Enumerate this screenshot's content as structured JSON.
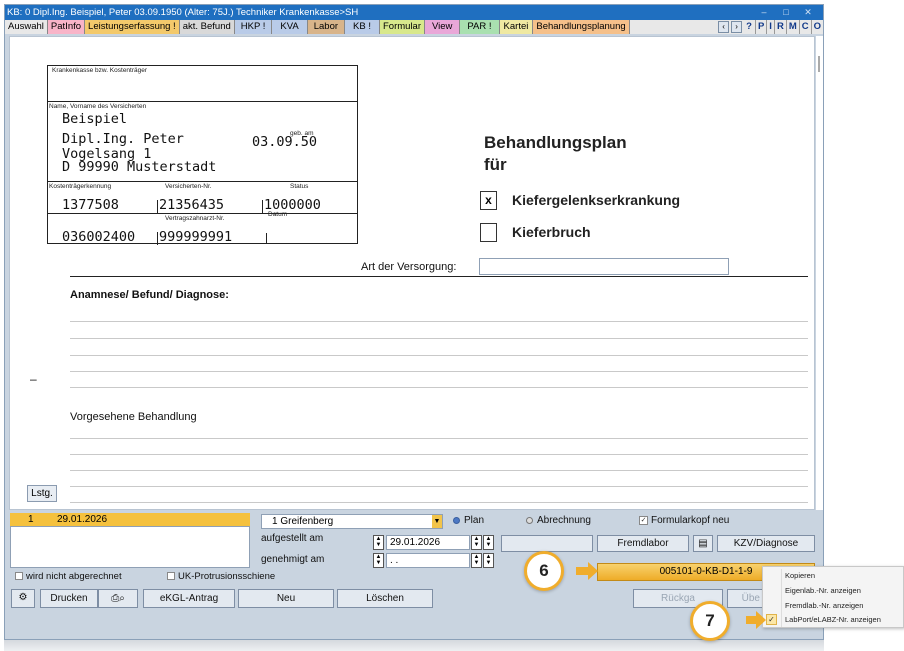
{
  "window": {
    "title": "KB: 0  Dipl.Ing. Beispiel, Peter  03.09.1950 (Alter: 75J.)  Techniker Krankenkasse>SH",
    "controls": [
      "–",
      "□",
      "✕"
    ]
  },
  "tabs": [
    {
      "label": "Auswahl",
      "bg": "#e8e8e8"
    },
    {
      "label": "PatInfo",
      "bg": "#f8b4c8"
    },
    {
      "label": "Leistungserfassung !",
      "bg": "#f3c96b"
    },
    {
      "label": "akt. Befund",
      "bg": "#d9d9d9"
    },
    {
      "label": "HKP !",
      "bg": "#b9cbe8"
    },
    {
      "label": "KVA",
      "bg": "#b9cbe8"
    },
    {
      "label": "Labor",
      "bg": "#d8b48a"
    },
    {
      "label": "KB !",
      "bg": "#b9cbe8"
    },
    {
      "label": "Formular",
      "bg": "#d8e88c"
    },
    {
      "label": "View",
      "bg": "#e9a7d8"
    },
    {
      "label": "PAR !",
      "bg": "#a9e0b0"
    },
    {
      "label": "Kartei",
      "bg": "#efe9a2"
    },
    {
      "label": "Behandlungsplanung",
      "bg": "#f5c08a"
    }
  ],
  "tab_right": {
    "prev": "‹",
    "next": "›",
    "help": "?",
    "letters": [
      "P",
      "I",
      "R",
      "M",
      "C",
      "O"
    ]
  },
  "form": {
    "insurer_label": "Krankenkasse bzw. Kostenträger",
    "name_label": "Name, Vorname des Versicherten",
    "surname": "Beispiel",
    "firstname": "Dipl.Ing. Peter",
    "born_label": "geb. am",
    "born": "03.09.50",
    "street": "Vogelsang 1",
    "city": "D 99990 Musterstadt",
    "cost_id_label": "Kostenträgerkennung",
    "cost_id": "1377508",
    "insured_no_label": "Versicherten-Nr.",
    "insured_no": "21356435",
    "status_label": "Status",
    "status": "1000000",
    "dentist_no_label": "Vertragszahnarzt-Nr.",
    "date_label": "Datum",
    "bsnr": "036002400",
    "dentist_no": "999999991",
    "title1": "Behandlungsplan",
    "title2": "für",
    "option1_mark": "x",
    "option1": "Kiefergelenkserkrankung",
    "option2": "Kieferbruch",
    "care_type_label": "Art der Versorgung:",
    "care_type_value": "",
    "anamnesis": "Anamnese/ Befund/ Diagnose:",
    "planned": "Vorgesehene Behandlung",
    "dash": "–"
  },
  "lstg": "Lstg.",
  "list": {
    "selected": {
      "no": "1",
      "date": "29.01.2026"
    }
  },
  "location": {
    "value": "1 Greifenberg"
  },
  "options": {
    "plan": "Plan",
    "billing": "Abrechnung",
    "header_new": "Formularkopf neu"
  },
  "dates": {
    "created_label": "aufgestellt am",
    "created": "29.01.2026",
    "approved_label": "genehmigt am",
    "approved": " .   .  "
  },
  "buttons": {
    "fremdlabor": "Fremdlabor",
    "kzv": "KZV/Diagnose",
    "lab_no": "005101-0-KB-D1-1-9",
    "drucken": "Drucken",
    "ekgl": "eKGL-Antrag",
    "neu": "Neu",
    "loeschen": "Löschen",
    "rueckgabe": "Rückga",
    "ueber": "Übe"
  },
  "checkboxes": {
    "not_billed": "wird nicht abgerechnet",
    "uk": "UK-Protrusionsschiene"
  },
  "markers": {
    "m6": "6",
    "m7": "7"
  },
  "context_menu": [
    {
      "label": "Kopieren",
      "checked": false
    },
    {
      "label": "Eigenlab.-Nr. anzeigen",
      "checked": false
    },
    {
      "label": "Fremdlab.-Nr. anzeigen",
      "checked": false
    },
    {
      "label": "LabPort/eLABZ-Nr. anzeigen",
      "checked": true
    }
  ],
  "accent": "#f0ad2c",
  "selection_color": "#f5c13d"
}
